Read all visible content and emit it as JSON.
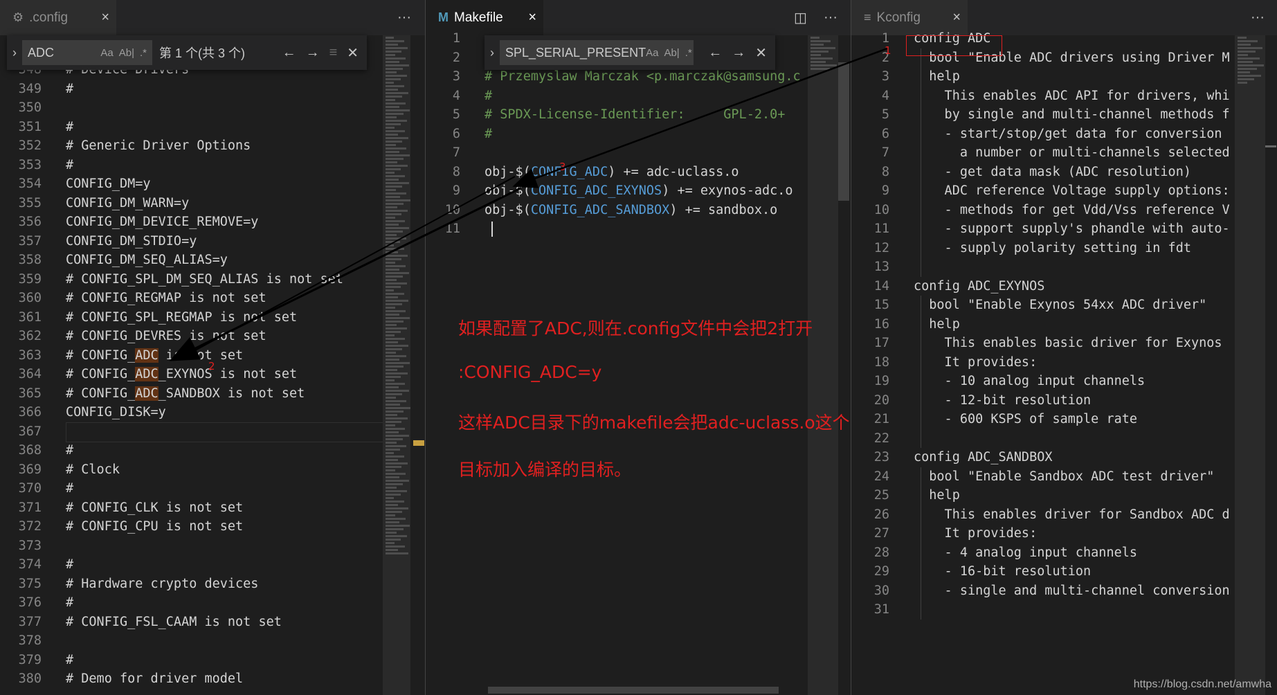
{
  "pane1": {
    "tab": {
      "icon": "gear-icon",
      "title": ".config",
      "close": "×"
    },
    "actions": {
      "more": "···"
    },
    "find": {
      "chevron": "›",
      "query": "ADC",
      "case": "Aa",
      "word": "Ab|",
      "regex": ".*",
      "status": "第 1 个(共 3 个)",
      "prev": "←",
      "next": "→",
      "selection": "≡",
      "close": "✕"
    },
    "lines": [
      {
        "n": "348",
        "t": "# Device Drivers"
      },
      {
        "n": "349",
        "t": "#"
      },
      {
        "n": "350",
        "t": ""
      },
      {
        "n": "351",
        "t": "#"
      },
      {
        "n": "352",
        "t": "# Generic Driver Options"
      },
      {
        "n": "353",
        "t": "#"
      },
      {
        "n": "354",
        "t": "CONFIG_DM=y"
      },
      {
        "n": "355",
        "t": "CONFIG_DM_WARN=y"
      },
      {
        "n": "356",
        "t": "CONFIG_DM_DEVICE_REMOVE=y"
      },
      {
        "n": "357",
        "t": "CONFIG_DM_STDIO=y"
      },
      {
        "n": "358",
        "t": "CONFIG_DM_SEQ_ALIAS=y"
      },
      {
        "n": "359",
        "t": "# CONFIG_SPL_DM_SEQ_ALIAS is not set"
      },
      {
        "n": "360",
        "t": "# CONFIG_REGMAP is not set"
      },
      {
        "n": "361",
        "t": "# CONFIG_SPL_REGMAP is not set"
      },
      {
        "n": "362",
        "t": "# CONFIG_DEVRES is not set"
      },
      {
        "n": "363",
        "pre": "# CONFIG_",
        "hl": "ADC",
        "post": " is not set"
      },
      {
        "n": "364",
        "pre": "# CONFIG_",
        "hl": "ADC",
        "post": "_EXYNOS is not set"
      },
      {
        "n": "365",
        "pre": "# CONFIG_",
        "hl": "ADC",
        "post": "_SANDBOX is not set"
      },
      {
        "n": "366",
        "t": "CONFIG_DISK=y"
      },
      {
        "n": "367",
        "t": ""
      },
      {
        "n": "368",
        "t": "#"
      },
      {
        "n": "369",
        "t": "# Clock"
      },
      {
        "n": "370",
        "t": "#"
      },
      {
        "n": "371",
        "t": "# CONFIG_CLK is not set"
      },
      {
        "n": "372",
        "t": "# CONFIG_CPU is not set"
      },
      {
        "n": "373",
        "t": ""
      },
      {
        "n": "374",
        "t": "#"
      },
      {
        "n": "375",
        "t": "# Hardware crypto devices"
      },
      {
        "n": "376",
        "t": "#"
      },
      {
        "n": "377",
        "t": "# CONFIG_FSL_CAAM is not set"
      },
      {
        "n": "378",
        "t": ""
      },
      {
        "n": "379",
        "t": "#"
      },
      {
        "n": "380",
        "t": "# Demo for driver model"
      }
    ]
  },
  "pane2": {
    "tab": {
      "icon": "M",
      "title": "Makefile",
      "close": "×"
    },
    "actions": {
      "split": "◫",
      "more": "···"
    },
    "find": {
      "chevron": "›",
      "query": "SPL_SERIAL_PRESENT",
      "case": "Aa",
      "word": "Ab|",
      "regex": ".*",
      "prev": "←",
      "next": "→",
      "close": "✕"
    },
    "lines": [
      {
        "n": "1",
        "t": ""
      },
      {
        "n": "2",
        "t": ""
      },
      {
        "n": "3",
        "t": "# Przemyslaw Marczak <p.marczak@samsung.c"
      },
      {
        "n": "4",
        "t": "#"
      },
      {
        "n": "5",
        "t": "# SPDX-License-Identifier:     GPL-2.0+"
      },
      {
        "n": "6",
        "t": "#"
      },
      {
        "n": "7",
        "t": ""
      },
      {
        "n": "8",
        "a": "obj-$(",
        "b": "CONFIG_ADC",
        "c": ") += adc-uclass.o"
      },
      {
        "n": "9",
        "a": "obj-$(",
        "b": "CONFIG_ADC_EXYNOS",
        "c": ") += exynos-adc.o"
      },
      {
        "n": "10",
        "a": "obj-$(",
        "b": "CONFIG_ADC_SANDBOX",
        "c": ") += sandbox.o"
      },
      {
        "n": "11",
        "t": ""
      }
    ],
    "note": {
      "line1": "如果配置了ADC,则在.config文件中会把2打开",
      "line2": ":CONFIG_ADC=y",
      "line3": "这样ADC目录下的makefile会把adc-uclass.o这个",
      "line4": "目标加入编译的目标。"
    }
  },
  "pane3": {
    "tab": {
      "icon": "list-icon",
      "title": "Kconfig",
      "close": "×"
    },
    "actions": {
      "more": "···"
    },
    "lines": [
      {
        "n": "1",
        "t": "config ADC"
      },
      {
        "n": "2",
        "t": "  bool \"Enable ADC drivers using Driver M"
      },
      {
        "n": "3",
        "t": "  help"
      },
      {
        "n": "4",
        "t": "    This enables ADC API for drivers, whi"
      },
      {
        "n": "5",
        "t": "    by single and multi-channel methods f"
      },
      {
        "n": "6",
        "t": "    - start/stop/get data for conversion"
      },
      {
        "n": "7",
        "t": "      a number or multi-channels selected"
      },
      {
        "n": "8",
        "t": "    - get data mask (ADC resolution)"
      },
      {
        "n": "9",
        "t": "    ADC reference Voltage supply options:"
      },
      {
        "n": "10",
        "t": "    - methods for get Vdd/Vss reference V"
      },
      {
        "n": "11",
        "t": "    - support supply's phandle with auto-"
      },
      {
        "n": "12",
        "t": "    - supply polarity setting in fdt"
      },
      {
        "n": "13",
        "t": ""
      },
      {
        "n": "14",
        "t": "config ADC_EXYNOS"
      },
      {
        "n": "15",
        "t": "  bool \"Enable Exynos 54xx ADC driver\""
      },
      {
        "n": "16",
        "t": "  help"
      },
      {
        "n": "17",
        "t": "    This enables basic driver for Exynos"
      },
      {
        "n": "18",
        "t": "    It provides:"
      },
      {
        "n": "19",
        "t": "    - 10 analog input channels"
      },
      {
        "n": "20",
        "t": "    - 12-bit resolution"
      },
      {
        "n": "21",
        "t": "    - 600 KSPS of sample rate"
      },
      {
        "n": "22",
        "t": ""
      },
      {
        "n": "23",
        "t": "config ADC_SANDBOX"
      },
      {
        "n": "24",
        "t": "  bool \"Enable Sandbox ADC test driver\""
      },
      {
        "n": "25",
        "t": "  help"
      },
      {
        "n": "26",
        "t": "    This enables driver for Sandbox ADC d"
      },
      {
        "n": "27",
        "t": "    It provides:"
      },
      {
        "n": "28",
        "t": "    - 4 analog input channels"
      },
      {
        "n": "29",
        "t": "    - 16-bit resolution"
      },
      {
        "n": "30",
        "t": "    - single and multi-channel conversion"
      },
      {
        "n": "31",
        "t": ""
      }
    ]
  },
  "markers": {
    "m1": "1",
    "m2": "2",
    "m3": "3"
  },
  "watermark": "https://blog.csdn.net/amwha",
  "colors": {
    "background": "#1e1e1e",
    "annotation": "#e02020",
    "match_highlight": "#613214",
    "macro": "#569cd6",
    "comment": "#6a9955"
  }
}
